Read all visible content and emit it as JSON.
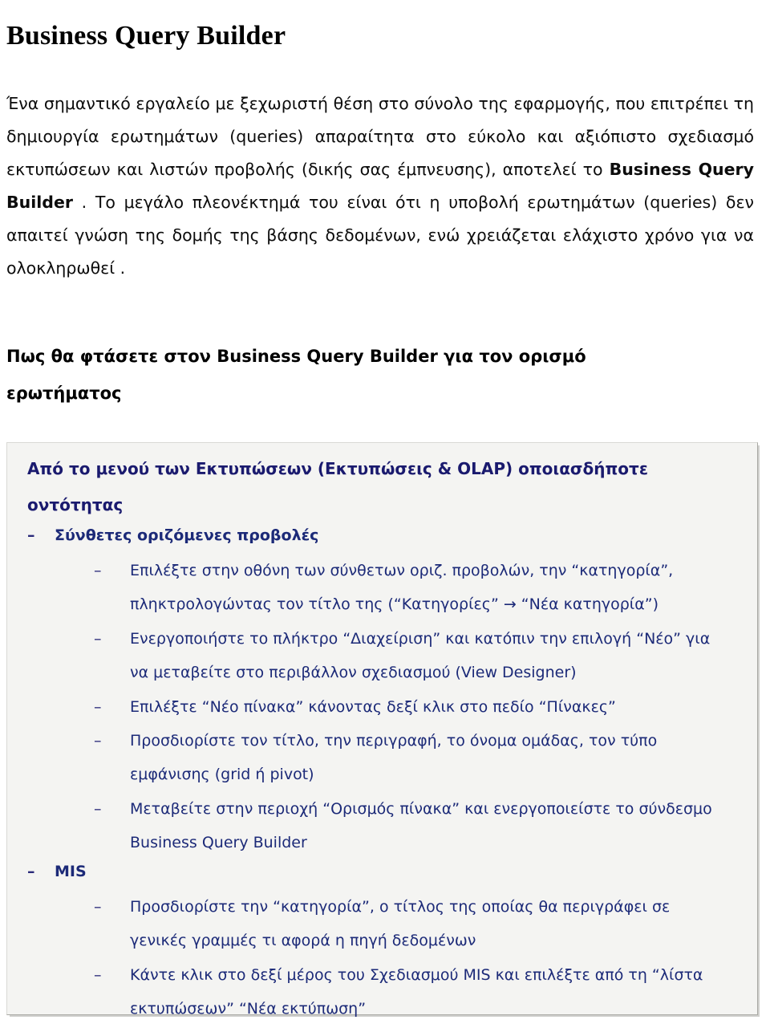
{
  "document": {
    "title": "Business Query Builder"
  },
  "intro": {
    "part1": "Ένα σημαντικό εργαλείο με ξεχωριστή θέση στο σύνολο της εφαρμογής, που επιτρέπει τη δημιουργία ερωτημάτων (queries) απαραίτητα στο εύκολο και αξιόπιστο σχεδιασμό εκτυπώσεων και λιστών προβολής (δικής σας έμπνευσης), αποτελεί το ",
    "bold1": "Business Query Builder",
    "part2": " . Το μεγάλο πλεονέκτημά του είναι ότι η υποβολή ερωτημάτων (queries) δεν απαιτεί γνώση της δομής της βάσης δεδομένων, ενώ χρειάζεται ελάχιστο χρόνο για να ολοκληρωθεί ."
  },
  "section": {
    "heading_line1": "Πως θα φτάσετε στον Business Query Builder για τον ορισμό",
    "heading_line2": "ερωτήματος"
  },
  "box": {
    "heading_line1": "Από το μενού των Εκτυπώσεων (Εκτυπώσεις & OLAP) οποιασδήποτε",
    "heading_line2": "οντότητας",
    "bullet_marker": "–",
    "items": [
      {
        "level": 1,
        "text": "Σύνθετες οριζόμενες προβολές",
        "last": ""
      },
      {
        "level": 2,
        "text": "Επιλέξτε στην οθόνη των σύνθετων οριζ. προβολών, την “κατηγορία”,",
        "last": "πληκτρολογώντας τον τίτλο της (“Κατηγορίες” → “Νέα κατηγορία”)"
      },
      {
        "level": 2,
        "text": "Ενεργοποιήστε το πλήκτρο “Διαχείριση” και κατόπιν την επιλογή “Νέο” για",
        "last": "να μεταβείτε στο περιβάλλον σχεδιασμού (View Designer)"
      },
      {
        "level": 2,
        "text": "Επιλέξτε “Νέο πίνακα” κάνοντας δεξί κλικ στο πεδίο “Πίνακες”",
        "last": ""
      },
      {
        "level": 2,
        "text": "Προσδιορίστε τον τίτλο, την περιγραφή, το όνομα ομάδας, τον τύπο",
        "last": "εμφάνισης (grid ή pivot)"
      },
      {
        "level": 2,
        "text": "Μεταβείτε στην περιοχή “Ορισμός πίνακα” και ενεργοποιείστε το σύνδεσμο",
        "last": "Business Query Builder"
      },
      {
        "level": 1,
        "text": "MIS",
        "last": ""
      },
      {
        "level": 2,
        "text": "Προσδιορίστε την “κατηγορία”, ο τίτλος της οποίας θα περιγράφει σε",
        "last": "γενικές γραμμές τι αφορά η πηγή δεδομένων"
      },
      {
        "level": 2,
        "text": "Κάντε κλικ στο δεξί μέρος του Σχεδιασμού MIS και επιλέξτε από τη “λίστα",
        "last": "εκτυπώσεων” “Νέα εκτύπωση”"
      }
    ]
  },
  "colors": {
    "page_background": "#ffffff",
    "body_text": "#0c0c0c",
    "heading_text": "#000000",
    "box_background": "#f4f4f2",
    "box_border": "#d9d9d5",
    "box_text_navy": "#1c2a78",
    "box_heading_navy": "#1a1a6e"
  }
}
